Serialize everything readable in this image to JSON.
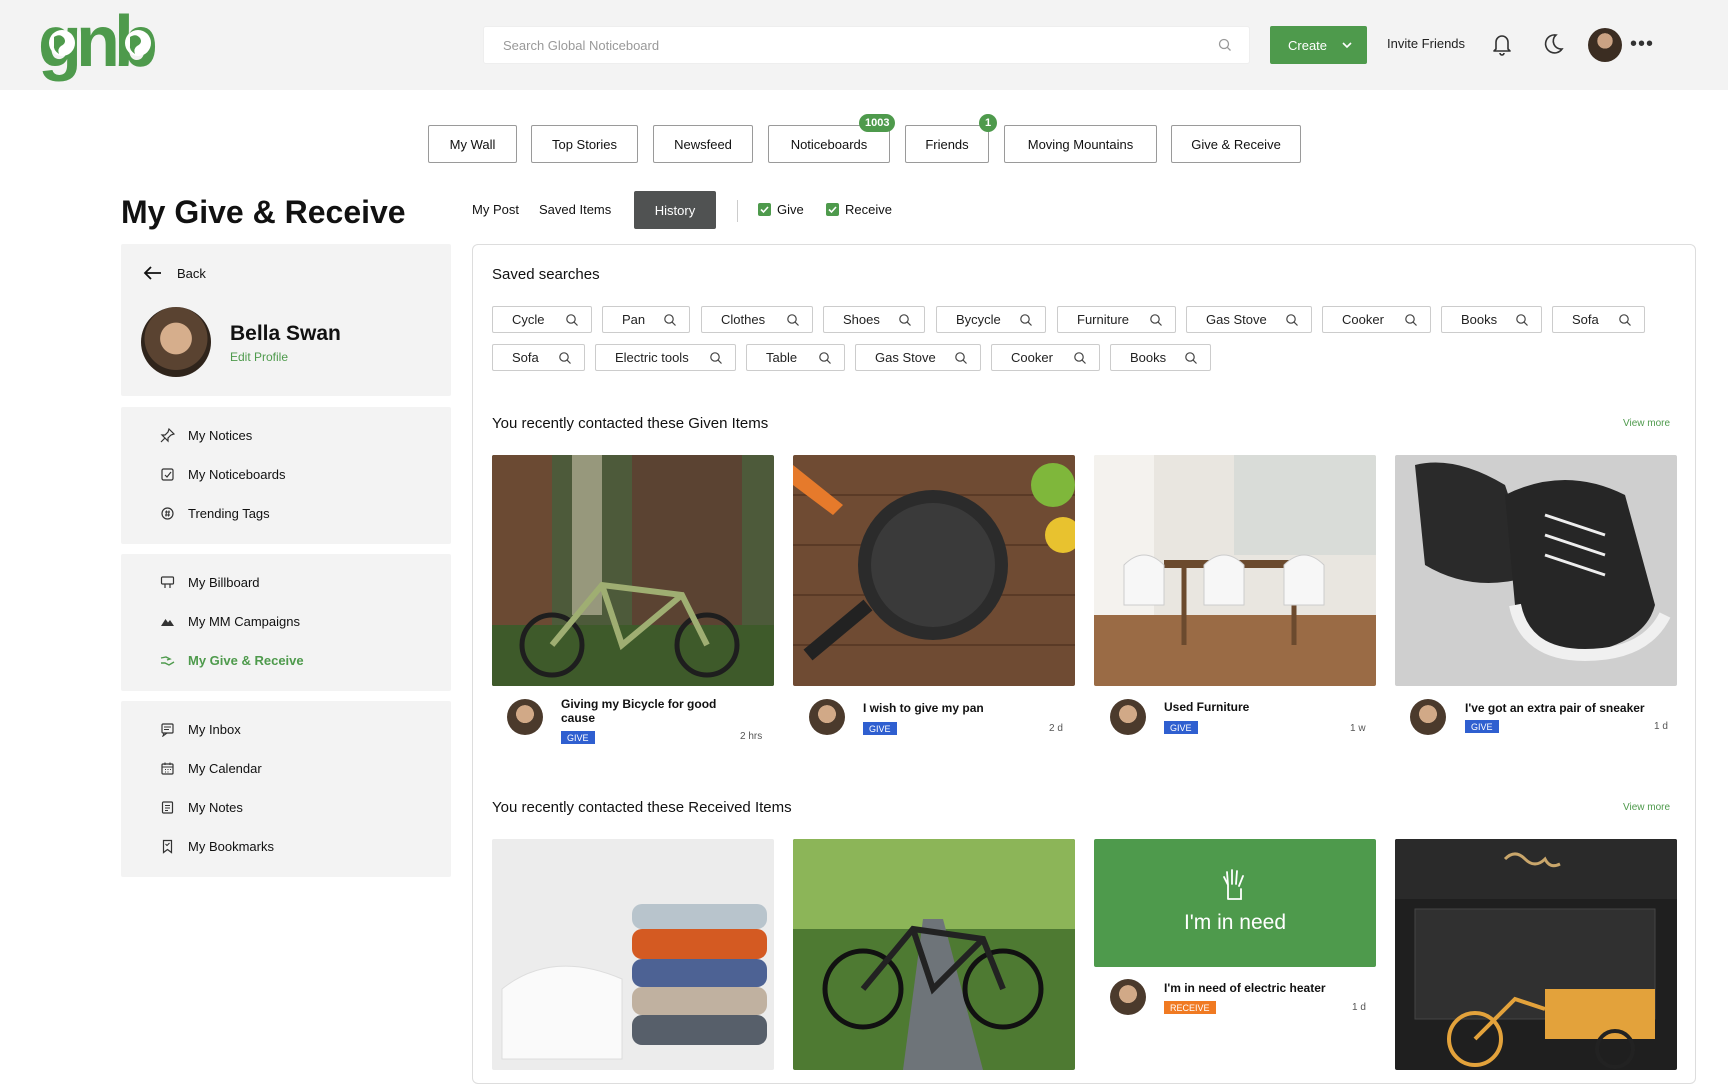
{
  "header": {
    "search_placeholder": "Search Global Noticeboard",
    "create_label": "Create",
    "invite_label": "Invite Friends"
  },
  "nav": {
    "tabs": [
      {
        "label": "My Wall"
      },
      {
        "label": "Top Stories"
      },
      {
        "label": "Newsfeed"
      },
      {
        "label": "Noticeboards",
        "badge": "1003"
      },
      {
        "label": "Friends",
        "badge": "1"
      },
      {
        "label": "Moving Mountains"
      },
      {
        "label": "Give & Receive"
      }
    ]
  },
  "page": {
    "title": "My Give & Receive",
    "subtabs": [
      "My Post",
      "Saved Items",
      "History"
    ],
    "filters": [
      "Give",
      "Receive"
    ]
  },
  "sidebar": {
    "back_label": "Back",
    "profile_name": "Bella Swan",
    "edit_profile": "Edit Profile",
    "items": [
      {
        "label": "My Notices",
        "icon": "pin-icon"
      },
      {
        "label": "My Noticeboards",
        "icon": "noticeboard-icon"
      },
      {
        "label": "Trending Tags",
        "icon": "tag-icon"
      },
      {
        "label": "My Billboard",
        "icon": "billboard-icon"
      },
      {
        "label": "My MM Campaigns",
        "icon": "mountain-icon"
      },
      {
        "label": "My Give & Receive",
        "icon": "give-receive-icon",
        "active": true
      },
      {
        "label": "My Inbox",
        "icon": "inbox-icon"
      },
      {
        "label": "My Calendar",
        "icon": "calendar-icon"
      },
      {
        "label": "My Notes",
        "icon": "notes-icon"
      },
      {
        "label": "My Bookmarks",
        "icon": "bookmark-icon"
      }
    ]
  },
  "saved_searches": {
    "title": "Saved searches",
    "chips": [
      "Cycle",
      "Pan",
      "Clothes",
      "Shoes",
      "Bycycle",
      "Furniture",
      "Gas Stove",
      "Cooker",
      "Books",
      "Sofa",
      "Sofa",
      "Electric tools",
      "Table",
      "Gas Stove",
      "Cooker",
      "Books"
    ]
  },
  "given": {
    "title": "You recently contacted these Given Items",
    "view_more": "View more",
    "cards": [
      {
        "title": "Giving my Bicycle for good cause",
        "tag": "GIVE",
        "time": "2 hrs"
      },
      {
        "title": "I wish to give my pan",
        "tag": "GIVE",
        "time": "2 d"
      },
      {
        "title": "Used Furniture",
        "tag": "GIVE",
        "time": "1 w"
      },
      {
        "title": "I've got an extra pair of sneaker",
        "tag": "GIVE",
        "time": "1 d"
      }
    ]
  },
  "received": {
    "title": "You recently contacted these Received Items",
    "view_more": "View more",
    "need_label": "I'm in need",
    "need_card": {
      "title": "I'm in need of electric heater",
      "tag": "RECEIVE",
      "time": "1 d"
    }
  },
  "colors": {
    "accent": "#4e9a4c",
    "give": "#2f5fd0",
    "receive": "#f07a22",
    "dark_button": "#505252"
  }
}
